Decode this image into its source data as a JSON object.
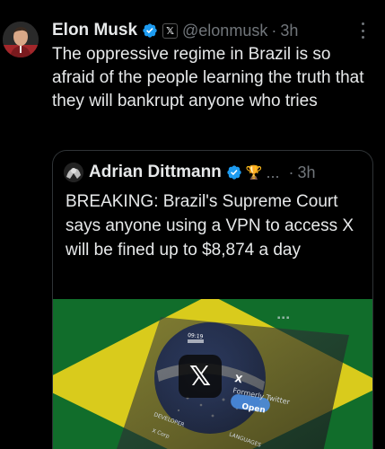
{
  "author": {
    "name": "Elon Musk",
    "handle": "@elonmusk",
    "affiliate_badge": "𝕏",
    "time": "3h",
    "separator": "·"
  },
  "post": {
    "text": "The oppressive regime in Brazil is so afraid of the people learning the truth that they will bankrupt anyone who tries"
  },
  "quoted": {
    "name": "Adrian Dittmann",
    "badge_emoji": "🏆",
    "ellipsis": "...",
    "separator": "·",
    "time": "3h",
    "text": "BREAKING: Brazil's Supreme Court says anyone using a VPN to access X will be fined up to $8,874 a day",
    "image": {
      "app_name": "X",
      "app_subtitle": "Formerly Twitter",
      "open_button": "Open",
      "developer_label": "DEVELOPER",
      "developer_value": "X Corp",
      "languages_label": "LANGUAGES",
      "status_time": "09:19"
    }
  },
  "colors": {
    "background": "#000000",
    "text_primary": "#e7e9ea",
    "text_secondary": "#71767b",
    "verified_blue": "#1d9bf0",
    "border": "#2f3336",
    "flag_green": "#17883c",
    "flag_yellow": "#e6d21e",
    "flag_blue": "#1f3a8a"
  },
  "icons": {
    "verified": "verified-badge-icon",
    "affiliate": "x-affiliate-icon",
    "more": "more-options-icon"
  }
}
